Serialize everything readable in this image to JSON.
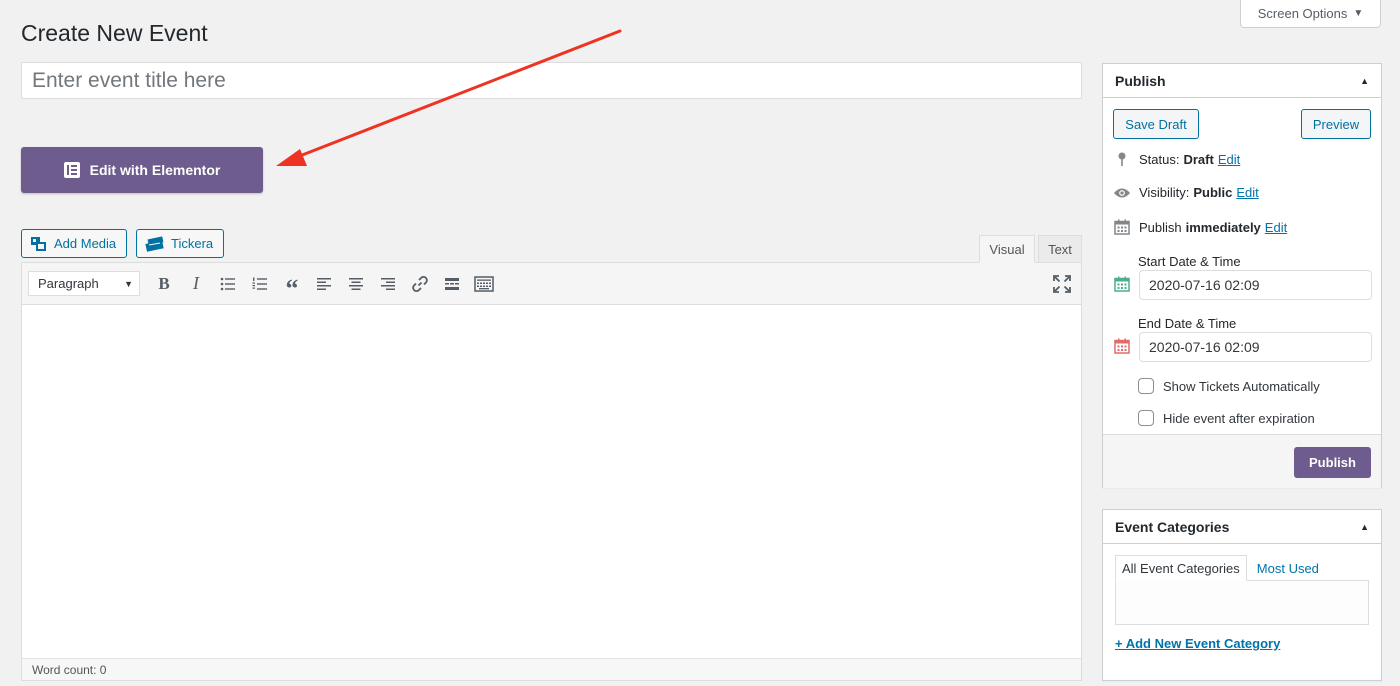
{
  "screen_options": {
    "label": "Screen Options"
  },
  "page": {
    "title": "Create New Event"
  },
  "event_title": {
    "placeholder": "Enter event title here",
    "value": ""
  },
  "elementor": {
    "label": "Edit with Elementor"
  },
  "media_buttons": {
    "add_media": "Add Media",
    "tickera": "Tickera"
  },
  "editor": {
    "tabs": {
      "visual": "Visual",
      "text": "Text"
    },
    "format_select": "Paragraph",
    "word_count_label": "Word count: 0"
  },
  "publish_box": {
    "title": "Publish",
    "save_draft": "Save Draft",
    "preview": "Preview",
    "status_label": "Status:",
    "status_value": "Draft",
    "visibility_label": "Visibility:",
    "visibility_value": "Public",
    "publish_label": "Publish",
    "publish_value": "immediately",
    "edit_link": "Edit",
    "start_date_label": "Start Date & Time",
    "start_date_value": "2020-07-16 02:09",
    "end_date_label": "End Date & Time",
    "end_date_value": "2020-07-16 02:09",
    "show_tickets_label": "Show Tickets Automatically",
    "hide_event_label": "Hide event after expiration",
    "publish_button": "Publish"
  },
  "categories_box": {
    "title": "Event Categories",
    "tab_all": "All Event Categories",
    "tab_most_used": "Most Used",
    "add_new": "+ Add New Event Category"
  },
  "colors": {
    "accent_purple": "#6d5c8d",
    "link_blue": "#0073aa",
    "button_blue": "#0071a1",
    "annotation_arrow": "#ee3323",
    "start_calendar": "#4caf8a",
    "end_calendar": "#e06c6c"
  }
}
